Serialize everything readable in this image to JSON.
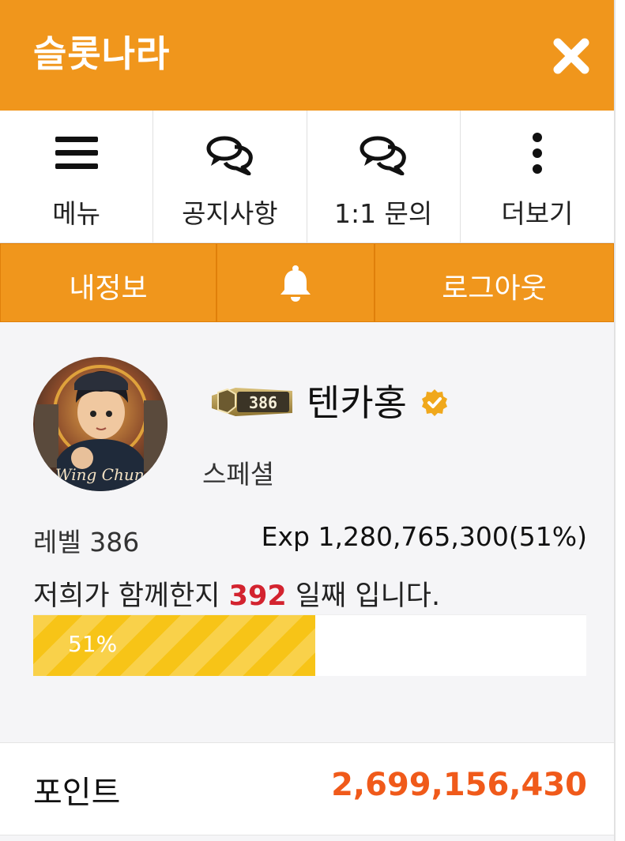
{
  "header": {
    "title": "슬롯나라",
    "close_icon": "close-icon"
  },
  "quick_nav": [
    {
      "icon": "menu-icon",
      "label": "메뉴"
    },
    {
      "icon": "chat-bubbles-icon",
      "label": "공지사항"
    },
    {
      "icon": "chat-bubbles-icon",
      "label": "1:1 문의"
    },
    {
      "icon": "more-vertical-icon",
      "label": "더보기"
    }
  ],
  "account_bar": {
    "my_info_label": "내정보",
    "notification_icon": "bell-icon",
    "logout_label": "로그아웃"
  },
  "profile": {
    "avatar_caption": "Wing Chun",
    "level_badge": "386",
    "nickname": "텐카홍",
    "verified_icon": "verified-badge-icon",
    "grade": "스페셜",
    "level_text": "레벨 386",
    "exp_text": "Exp 1,280,765,300(51%)",
    "days_prefix": "저희가 함께한지 ",
    "days_count": "392",
    "days_suffix": " 일째 입니다.",
    "progress": 0.51,
    "progress_label": "51%"
  },
  "points": {
    "label": "포인트",
    "value": "2,699,156,430"
  },
  "colors": {
    "brand_orange": "#f0961c",
    "progress_yellow": "#f7c417",
    "days_red": "#d3232f",
    "points_orange": "#f05a1a"
  }
}
